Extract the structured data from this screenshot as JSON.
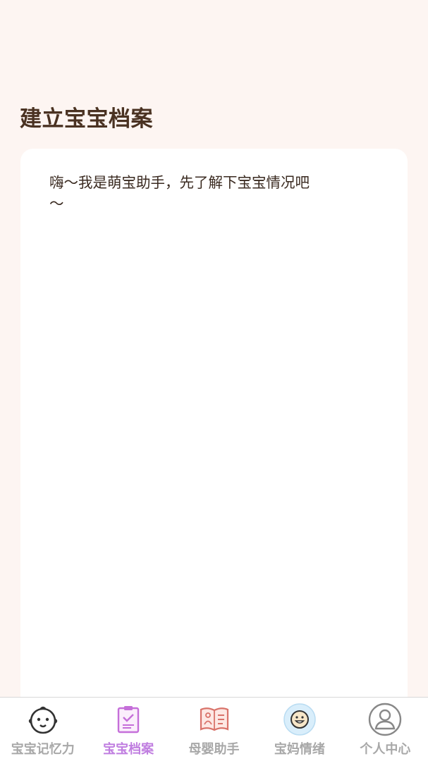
{
  "page": {
    "title": "建立宝宝档案"
  },
  "card": {
    "greeting": "嗨～我是萌宝助手，先了解下宝宝情况吧～"
  },
  "tabbar": {
    "active": "宝宝档案",
    "items": [
      {
        "label": "宝宝记忆力",
        "icon": "baby-face-icon"
      },
      {
        "label": "宝宝档案",
        "icon": "clipboard-check-icon"
      },
      {
        "label": "母婴助手",
        "icon": "mother-baby-book-icon"
      },
      {
        "label": "宝妈情绪",
        "icon": "smiley-face-icon"
      },
      {
        "label": "个人中心",
        "icon": "user-profile-icon"
      }
    ]
  },
  "colors": {
    "background": "#fdf5f2",
    "title": "#4a3222",
    "tab_active": "#c07ee0",
    "tab_inactive": "#a8a8a8"
  }
}
